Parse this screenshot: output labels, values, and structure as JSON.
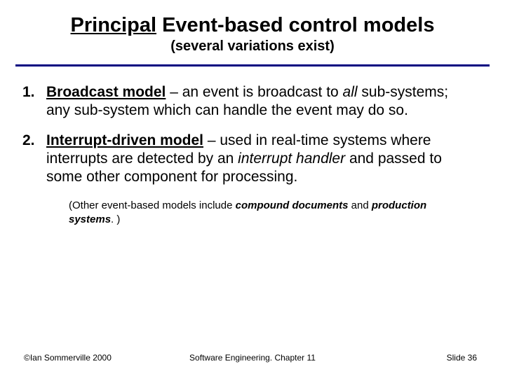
{
  "header": {
    "title_underlined": "Principal",
    "title_rest": " Event-based control models",
    "subtitle": "(several variations exist)"
  },
  "items": [
    {
      "num": "1.",
      "name": "Broadcast model",
      "lead": " – an event is broadcast to ",
      "emph1": "all",
      "after_emph1": " sub-systems; ",
      "mid": "any sub-system which can  handle the event may do so."
    },
    {
      "num": "2.",
      "name": "Interrupt-driven model",
      "lead": " – used in real-time systems where interrupts are detected by an ",
      "emph1": "interrupt handler",
      "after_emph1": " and passed to some other component for processing.",
      "mid": ""
    }
  ],
  "note": {
    "pre": "(Other event-based models include ",
    "b1": "compound documents",
    "mid": " and ",
    "b2": "production systems",
    "post": ". )"
  },
  "footer": {
    "left": "©Ian Sommerville 2000",
    "center": "Software Engineering. Chapter 11",
    "right": "Slide 36"
  }
}
